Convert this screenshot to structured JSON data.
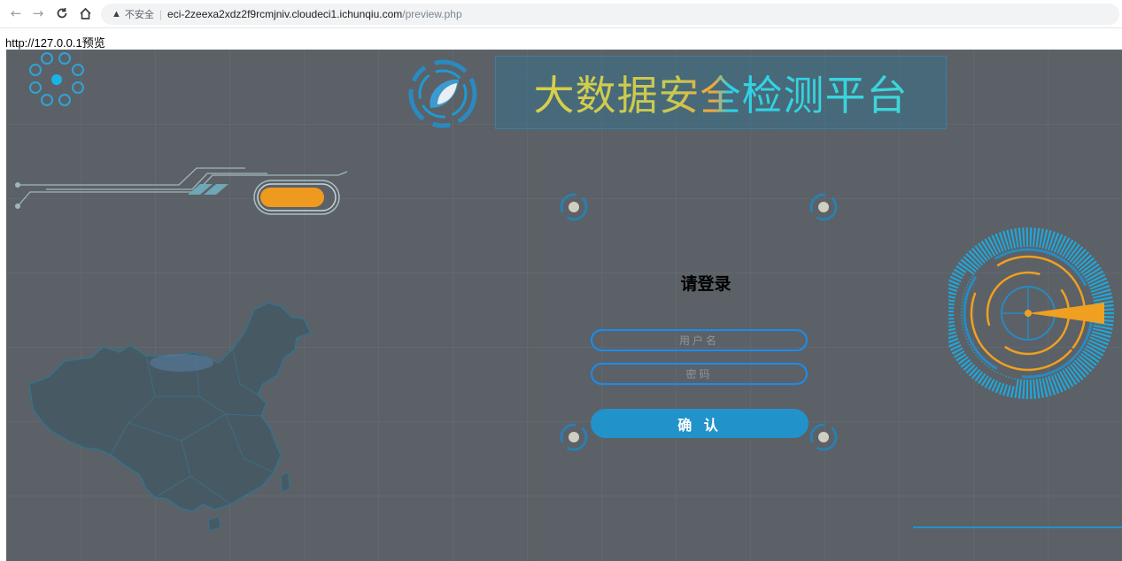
{
  "browser": {
    "back_icon": "arrow-left-icon",
    "forward_icon": "arrow-right-icon",
    "reload_icon": "reload-icon",
    "home_icon": "home-icon",
    "security_text": "不安全",
    "url_host": "eci-2zeexa2xdz2f9rcmjniv.cloudeci1.ichunqiu.com",
    "url_path": "/preview.php"
  },
  "preview_label": "http://127.0.0.1预览",
  "header": {
    "title": "大数据安全检测平台"
  },
  "login": {
    "title": "请登录",
    "username_placeholder": "用户名",
    "password_placeholder": "密码",
    "submit_label": "确 认"
  },
  "colors": {
    "background": "#5b6166",
    "accent_blue": "#1a8cf0",
    "button_blue": "#2292cb",
    "accent_orange": "#f0a020",
    "title_yellow": "#d8d04a",
    "title_cyan": "#2fd1e6"
  }
}
